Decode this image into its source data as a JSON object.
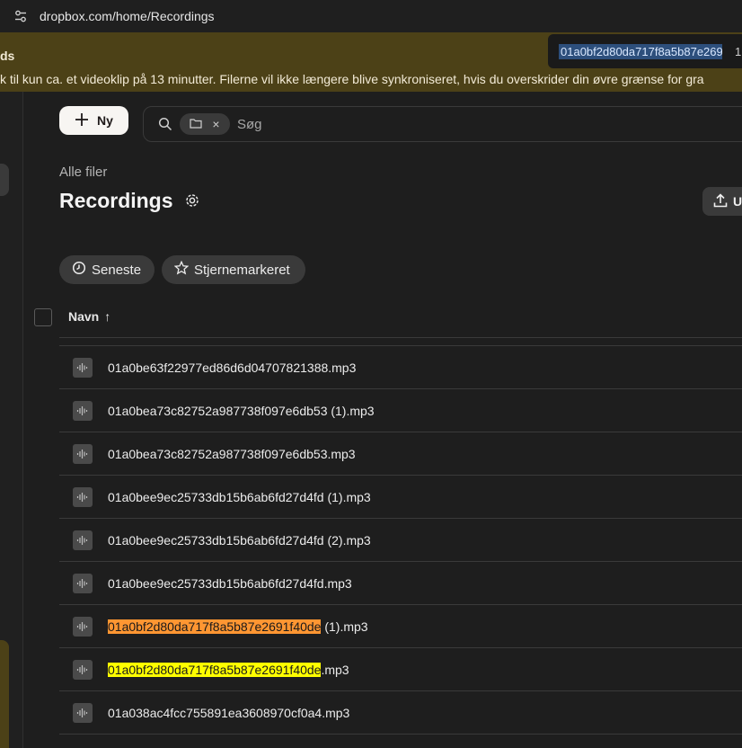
{
  "browser": {
    "url": "dropbox.com/home/Recordings"
  },
  "banner": {
    "title": "ds",
    "text": "k til kun ca. et videoklip på 13 minutter. Filerne vil ikke længere blive synkroniseret, hvis du overskrider din øvre grænse for gra"
  },
  "find": {
    "query": "01a0bf2d80da717f8a5b87e269",
    "count": "1"
  },
  "toolbar": {
    "new_label": "Ny",
    "search_placeholder": "Søg",
    "chip_close": "×"
  },
  "page": {
    "breadcrumb": "Alle filer",
    "title": "Recordings",
    "upload_label": "U"
  },
  "filters": {
    "recent": "Seneste",
    "starred": "Stjernemarkeret"
  },
  "table": {
    "column_name": "Navn",
    "sort_arrow": "↑",
    "rows": [
      {
        "pre": "",
        "match": "",
        "post": "01a0be63f22977ed86d6d04707821388.mp3"
      },
      {
        "pre": "",
        "match": "",
        "post": "01a0bea73c82752a987738f097e6db53 (1).mp3"
      },
      {
        "pre": "",
        "match": "",
        "post": "01a0bea73c82752a987738f097e6db53.mp3"
      },
      {
        "pre": "",
        "match": "",
        "post": "01a0bee9ec25733db15b6ab6fd27d4fd (1).mp3"
      },
      {
        "pre": "",
        "match": "",
        "post": "01a0bee9ec25733db15b6ab6fd27d4fd (2).mp3"
      },
      {
        "pre": "",
        "match": "",
        "post": "01a0bee9ec25733db15b6ab6fd27d4fd.mp3"
      },
      {
        "pre": "",
        "match": "01a0bf2d80da717f8a5b87e2691f40de",
        "post": " (1).mp3",
        "highlight": "orange"
      },
      {
        "pre": "",
        "match": "01a0bf2d80da717f8a5b87e2691f40de",
        "post": ".mp3",
        "highlight": "yellow"
      },
      {
        "pre": "",
        "match": "",
        "post": "01a038ac4fcc755891ea3608970cf0a4.mp3"
      }
    ]
  },
  "colors": {
    "banner_bg": "#4c4117",
    "highlight_current": "#ff9632",
    "highlight_other": "#ffff00"
  },
  "icons": {
    "site": "site-settings-icon",
    "new": "plus-icon",
    "search": "search-icon",
    "folder": "folder-icon",
    "settings": "gear-icon",
    "upload": "upload-icon",
    "recent": "clock-icon",
    "starred": "star-icon",
    "file": "audio-file-icon"
  }
}
